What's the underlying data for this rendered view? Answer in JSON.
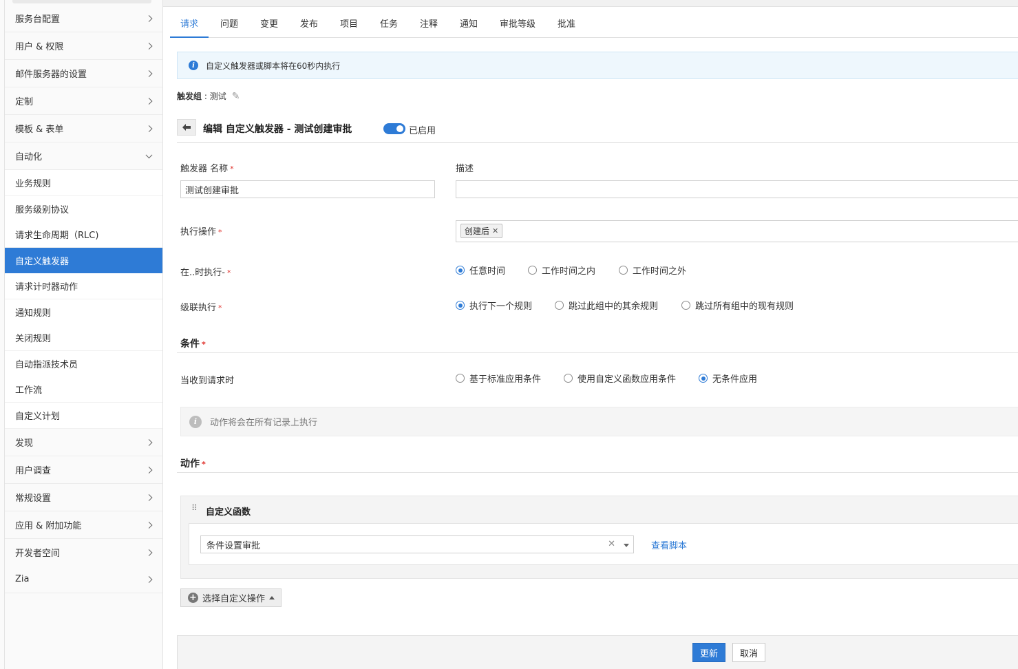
{
  "sidebar": {
    "sections": [
      {
        "label": "服务台配置"
      },
      {
        "label": "用户 & 权限"
      },
      {
        "label": "邮件服务器的设置"
      },
      {
        "label": "定制"
      },
      {
        "label": "模板 & 表单"
      },
      {
        "label": "自动化"
      }
    ],
    "automation_items": [
      {
        "label": "业务规则"
      },
      {
        "label": "服务级别协议"
      },
      {
        "label": "请求生命周期（RLC)"
      },
      {
        "label": "自定义触发器"
      },
      {
        "label": "请求计时器动作"
      },
      {
        "label": "通知规则"
      },
      {
        "label": "关闭规则"
      },
      {
        "label": "自动指派技术员"
      },
      {
        "label": "工作流"
      },
      {
        "label": "自定义计划"
      }
    ],
    "lower_sections": [
      {
        "label": "发现"
      },
      {
        "label": "用户调查"
      },
      {
        "label": "常规设置"
      },
      {
        "label": "应用 & 附加功能"
      },
      {
        "label": "开发者空间"
      },
      {
        "label": "Zia"
      }
    ]
  },
  "tabs": [
    {
      "label": "请求"
    },
    {
      "label": "问题"
    },
    {
      "label": "变更"
    },
    {
      "label": "发布"
    },
    {
      "label": "项目"
    },
    {
      "label": "任务"
    },
    {
      "label": "注释"
    },
    {
      "label": "通知"
    },
    {
      "label": "审批等级"
    },
    {
      "label": "批准"
    }
  ],
  "banner": {
    "text": "自定义触发器或脚本将在60秒内执行",
    "icon": "info-icon"
  },
  "trigger_group": {
    "label": "触发组",
    "separator": " : ",
    "value": "测试"
  },
  "header": {
    "title": "编辑 自定义触发器 - 测试创建审批",
    "toggle_label": "已启用"
  },
  "form": {
    "name_label": "触发器 名称",
    "name_value": "测试创建审批",
    "desc_label": "描述",
    "desc_value": "",
    "action_label": "执行操作",
    "action_chip": "创建后",
    "when_label": "在..时执行-",
    "when_options": [
      "任意时间",
      "工作时间之内",
      "工作时间之外"
    ],
    "cascade_label": "级联执行",
    "cascade_options": [
      "执行下一个规则",
      "跳过此组中的其余规则",
      "跳过所有组中的现有规则"
    ],
    "required_mark": "*"
  },
  "conditions": {
    "title": "条件",
    "receive_label": "当收到请求时",
    "options": [
      "基于标准应用条件",
      "使用自定义函数应用条件",
      "无条件应用"
    ],
    "note": "动作将会在所有记录上执行"
  },
  "actions": {
    "title": "动作",
    "block_title": "自定义函数",
    "selected_function": "条件设置审批",
    "view_script": "查看脚本",
    "add_button": "选择自定义操作"
  },
  "footer": {
    "update": "更新",
    "cancel": "取消"
  },
  "colors": {
    "accent": "#2e7bd6",
    "required": "#e0312b"
  }
}
